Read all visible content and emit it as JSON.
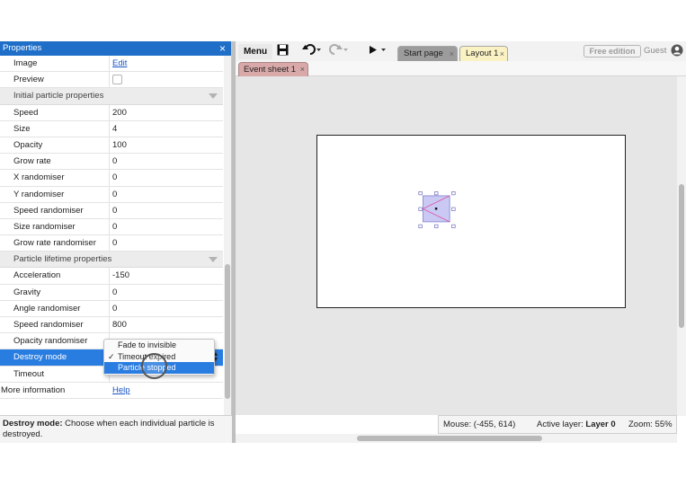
{
  "properties": {
    "title": "Properties",
    "close_glyph": "×",
    "rows_top": [
      {
        "key": "Image",
        "value": "Edit",
        "kind": "link"
      },
      {
        "key": "Preview",
        "value": "",
        "kind": "checkbox"
      }
    ],
    "section_initial": "Initial particle properties",
    "rows_initial": [
      {
        "key": "Speed",
        "value": "200"
      },
      {
        "key": "Size",
        "value": "4"
      },
      {
        "key": "Opacity",
        "value": "100"
      },
      {
        "key": "Grow rate",
        "value": "0"
      },
      {
        "key": "X randomiser",
        "value": "0"
      },
      {
        "key": "Y randomiser",
        "value": "0"
      },
      {
        "key": "Speed randomiser",
        "value": "0"
      },
      {
        "key": "Size randomiser",
        "value": "0"
      },
      {
        "key": "Grow rate randomiser",
        "value": "0"
      }
    ],
    "section_lifetime": "Particle lifetime properties",
    "rows_lifetime": [
      {
        "key": "Acceleration",
        "value": "-150"
      },
      {
        "key": "Gravity",
        "value": "0"
      },
      {
        "key": "Angle randomiser",
        "value": "0"
      },
      {
        "key": "Speed randomiser",
        "value": "800"
      },
      {
        "key": "Opacity randomiser",
        "value": ""
      }
    ],
    "destroy_mode": {
      "key": "Destroy mode"
    },
    "timeout": {
      "key": "Timeout"
    },
    "more_info": {
      "key": "More information",
      "value": "Help"
    },
    "description": {
      "label": "Destroy mode:",
      "text": " Choose when each individual particle is destroyed."
    },
    "dropdown": {
      "options": [
        "Fade to invisible",
        "Timeout expired",
        "Particle stopped"
      ],
      "checked_index": 1,
      "highlighted_index": 2,
      "check_glyph": "✓"
    }
  },
  "toolbar": {
    "menu_label": "Menu",
    "tabs": [
      {
        "label": "Start page",
        "close": "×"
      },
      {
        "label": "Layout 1",
        "close": "×"
      }
    ],
    "edition_badge": "Free edition",
    "user_label": "Guest"
  },
  "subtabs": [
    {
      "label": "Event sheet 1",
      "close": "×"
    }
  ],
  "status_bar": {
    "mouse": "Mouse: (-455, 614)",
    "active_layer_label": "Active layer: ",
    "active_layer_value": "Layer 0",
    "zoom": "Zoom: 55%"
  },
  "colors": {
    "panel_header": "#1f6fc9",
    "selection": "#2a7de0",
    "layout_tab": "#fbf2c4",
    "event_tab": "#d9a9a9"
  }
}
